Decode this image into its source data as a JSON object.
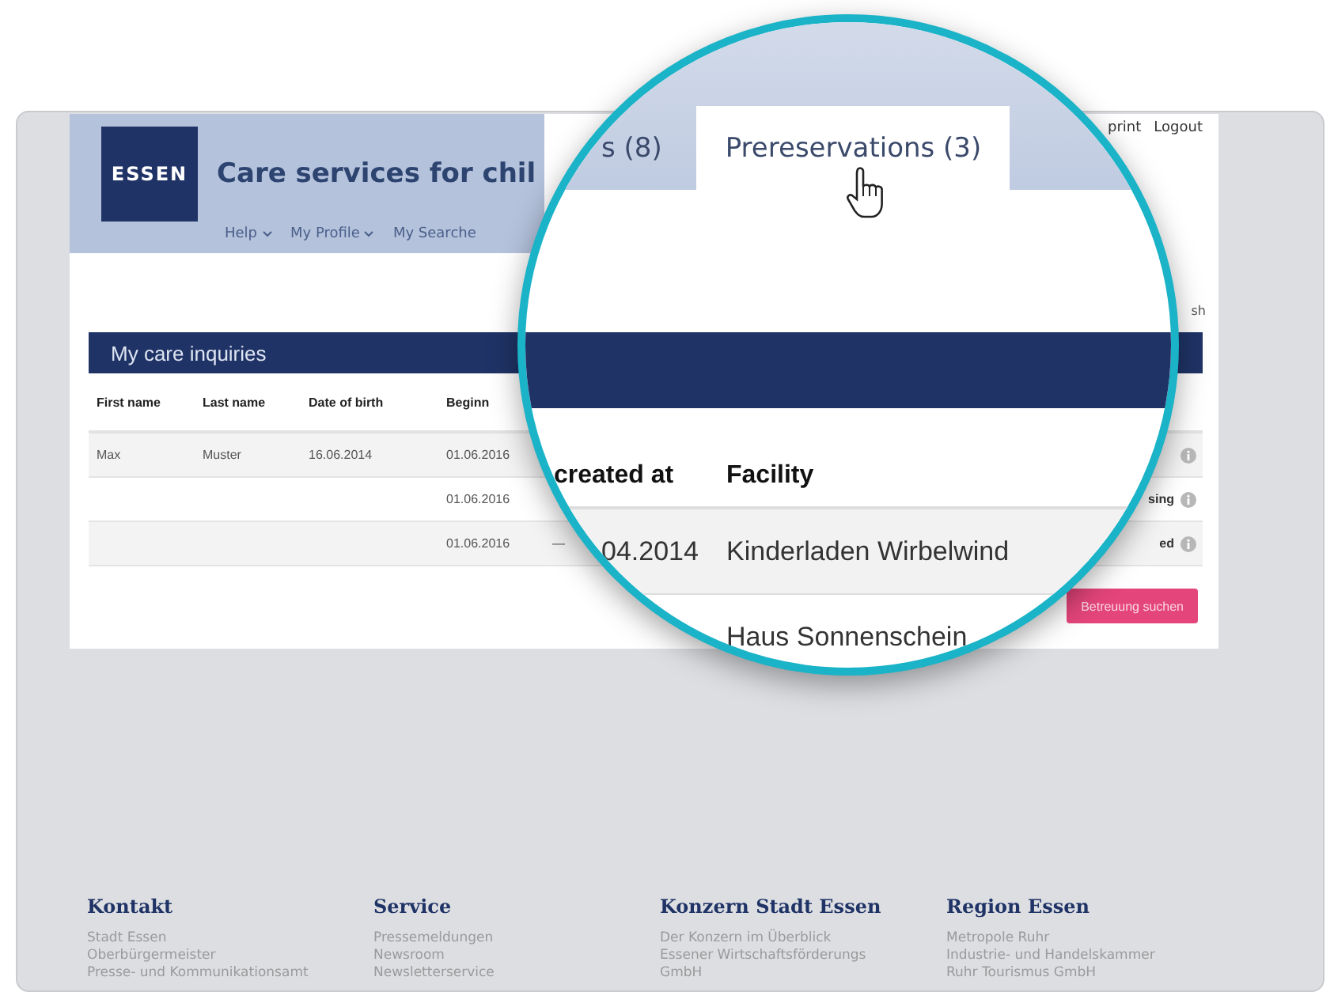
{
  "header": {
    "logo": "ESSEN",
    "title": "Care services for chil",
    "nav": [
      {
        "label": "Help",
        "dropdown": true
      },
      {
        "label": "My Profile",
        "dropdown": true
      },
      {
        "label": "My Searche",
        "dropdown": false
      }
    ],
    "top_links": [
      "print",
      "Logout"
    ]
  },
  "refresh_link": "sh",
  "inquiries": {
    "title": "My care inquiries",
    "columns": [
      "First name",
      "Last name",
      "Date of birth",
      "Beginn"
    ],
    "rows": [
      {
        "first_name": "Max",
        "last_name": "Muster",
        "date_of_birth": "16.06.2014",
        "begin": "01.06.2016",
        "info": true
      },
      {
        "begin": "01.06.2016",
        "status": "sing",
        "info": true
      },
      {
        "begin": "01.06.2016",
        "column_5": "—",
        "status": "ed",
        "info": true
      },
      {
        "action": "Betreuung suchen"
      }
    ]
  },
  "magnifier": {
    "tabs": [
      {
        "label": "s (8)",
        "selected": false
      },
      {
        "label": "Prereservations (3)",
        "selected": true
      }
    ],
    "columns": [
      "created at",
      "Facility"
    ],
    "rows": [
      {
        "created_at": "04.2014",
        "facility": "Kinderladen Wirbelwind"
      },
      {
        "facility": "Haus Sonnenschein"
      }
    ]
  },
  "footer": [
    {
      "heading": "Kontakt",
      "links": [
        "Stadt Essen",
        "Oberbürgermeister",
        "Presse- und Kommunikationsamt"
      ]
    },
    {
      "heading": "Service",
      "links": [
        "Pressemeldungen",
        "Newsroom",
        "Newsletterservice"
      ]
    },
    {
      "heading": "Konzern Stadt Essen",
      "links": [
        "Der Konzern im Überblick",
        "Essener Wirtschaftsförderungs",
        "GmbH"
      ]
    },
    {
      "heading": "Region Essen",
      "links": [
        "Metropole Ruhr",
        "Industrie- und Handelskammer",
        "Ruhr Tourismus GmbH"
      ]
    }
  ]
}
